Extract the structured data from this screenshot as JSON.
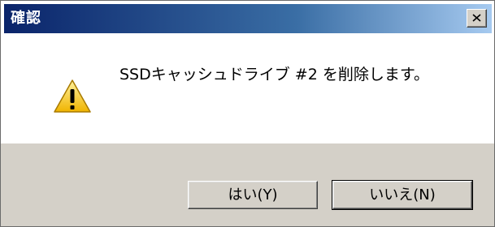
{
  "window": {
    "title": "確認",
    "close_icon": "close-icon"
  },
  "message": {
    "icon": "warning-icon",
    "text": "SSDキャッシュドライブ #2 を削除します。"
  },
  "buttons": {
    "yes_label": "はい(Y)",
    "no_label": "いいえ(N)"
  },
  "colors": {
    "titlebar_start": "#0a246a",
    "titlebar_end": "#a6caf0",
    "footer_bg": "#d4d0c8",
    "warning_yellow": "#f5c400"
  }
}
